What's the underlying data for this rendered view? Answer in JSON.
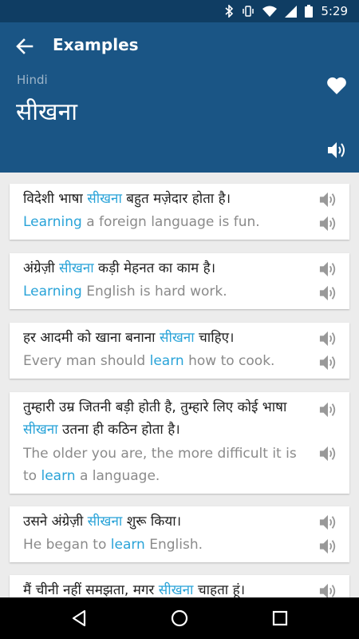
{
  "status": {
    "time": "5:29"
  },
  "toolbar": {
    "title": "Examples"
  },
  "word": {
    "language": "Hindi",
    "text": "सीखना"
  },
  "examples": [
    {
      "hi": [
        "विदेशी भाषा ",
        "सीखना",
        " बहुत मज़ेदार होता है।"
      ],
      "en": [
        "",
        "Learning",
        " a foreign language is fun."
      ]
    },
    {
      "hi": [
        "अंग्रेज़ी ",
        "सीखना",
        " कड़ी मेहनत का काम है।"
      ],
      "en": [
        "",
        "Learning",
        " English is hard work."
      ]
    },
    {
      "hi": [
        "हर आदमी को खाना बनाना ",
        "सीखना",
        " चाहिए।"
      ],
      "en": [
        "Every man should ",
        "learn",
        " how to cook."
      ]
    },
    {
      "hi": [
        "तुम्हारी उम्र जितनी बड़ी होती है, तुम्हारे लिए कोई भाषा ",
        "सीखना",
        " उतना ही कठिन होता है।"
      ],
      "en": [
        "The older you are, the more difficult it is to ",
        "learn",
        " a language."
      ]
    },
    {
      "hi": [
        "उसने अंग्रेज़ी ",
        "सीखना",
        " शुरू किया।"
      ],
      "en": [
        "He began to ",
        "learn",
        " English."
      ]
    },
    {
      "hi": [
        "मैं चीनी नहीं समझता, मगर ",
        "सीखना",
        " चाहता हूं।"
      ],
      "en": [
        "",
        "",
        ""
      ]
    }
  ],
  "colors": {
    "status_bar": "#0f3d63",
    "header": "#1a5585",
    "highlight": "#29a3d8"
  }
}
